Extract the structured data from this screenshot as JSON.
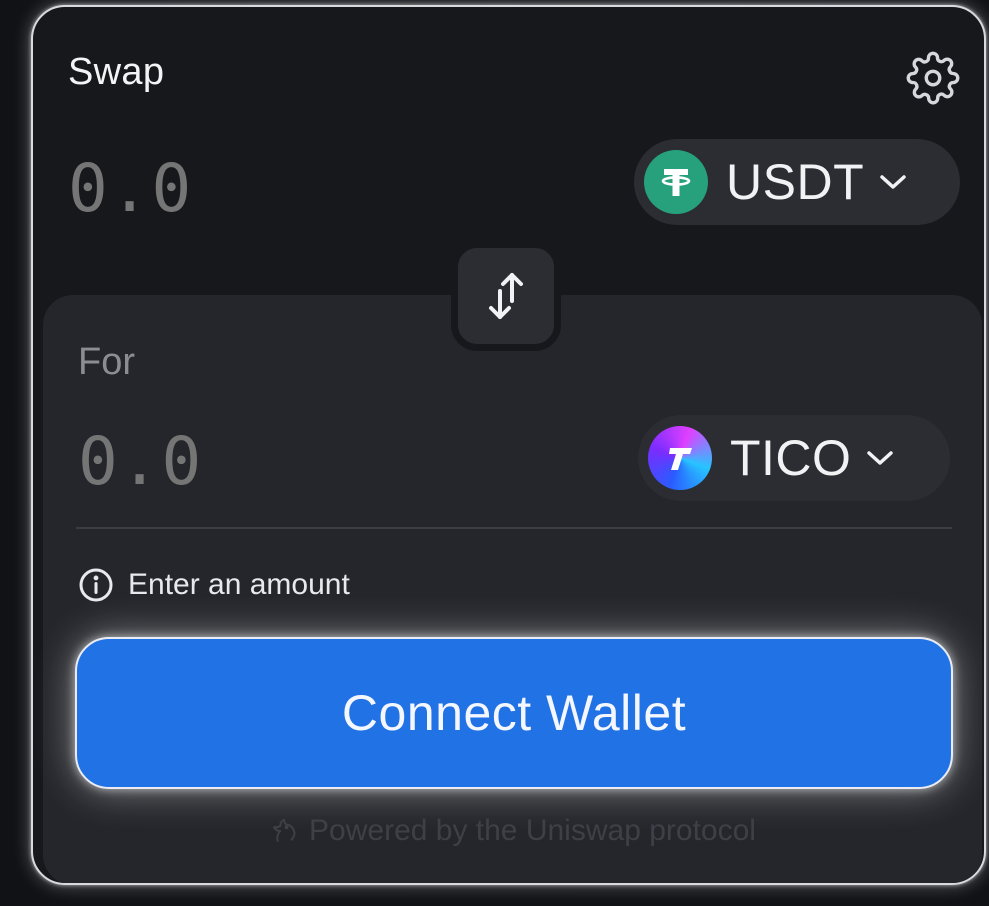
{
  "swap": {
    "title": "Swap",
    "settings_icon": "gear-icon",
    "input_amount_placeholder": "0.0",
    "input_token": {
      "symbol": "USDT",
      "icon": "usdt-logo-icon",
      "color": "#26a17b"
    },
    "toggle_icon": "arrows-up-down-icon",
    "output_label": "For",
    "output_amount_placeholder": "0.0",
    "output_token": {
      "symbol": "TICO",
      "icon": "tico-logo-icon"
    },
    "info_message": "Enter an amount",
    "connect_button_label": "Connect Wallet",
    "footer": "Powered by the Uniswap protocol"
  },
  "colors": {
    "accent": "#2172e5",
    "background": "#17181c",
    "panel": "#24262b",
    "pill": "#2b2d33"
  }
}
